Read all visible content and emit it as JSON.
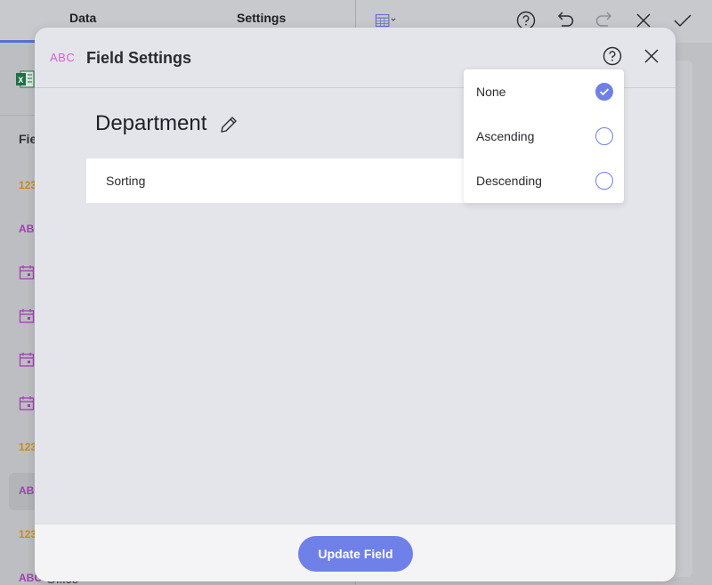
{
  "background": {
    "tabs": [
      {
        "label": "Data"
      },
      {
        "label": "Settings"
      }
    ],
    "fields_label": "Fie",
    "field_type_icons": [
      {
        "type": "number",
        "text": "123",
        "icon": "number-type-icon"
      },
      {
        "type": "text",
        "text": "ABC",
        "icon": "text-type-icon"
      },
      {
        "type": "date",
        "text": "",
        "icon": "calendar-icon"
      },
      {
        "type": "date",
        "text": "",
        "icon": "calendar-icon"
      },
      {
        "type": "date",
        "text": "",
        "icon": "calendar-icon"
      },
      {
        "type": "date",
        "text": "",
        "icon": "calendar-icon"
      },
      {
        "type": "number",
        "text": "123",
        "icon": "number-type-icon"
      },
      {
        "type": "text",
        "text": "ABC",
        "icon": "text-type-icon"
      },
      {
        "type": "number",
        "text": "123",
        "icon": "number-type-icon"
      },
      {
        "type": "text",
        "text": "ABC",
        "icon": "text-type-icon"
      }
    ],
    "last_field_partial": "Office",
    "toolbar_icons": [
      "table-view-icon",
      "help-icon",
      "undo-icon",
      "redo-icon",
      "close-icon",
      "check-icon"
    ]
  },
  "modal": {
    "type_icon_text": "ABC",
    "title": "Field Settings",
    "field_name": "Department",
    "sorting_label": "Sorting",
    "update_button": "Update Field"
  },
  "sort_dropdown": {
    "options": [
      {
        "label": "None",
        "checked": true
      },
      {
        "label": "Ascending",
        "checked": false
      },
      {
        "label": "Descending",
        "checked": false
      }
    ]
  },
  "colors": {
    "accent": "#6f80e8",
    "text_type": "#d65fd8",
    "number_type": "#c88a1e",
    "excel_green": "#1e7145"
  }
}
